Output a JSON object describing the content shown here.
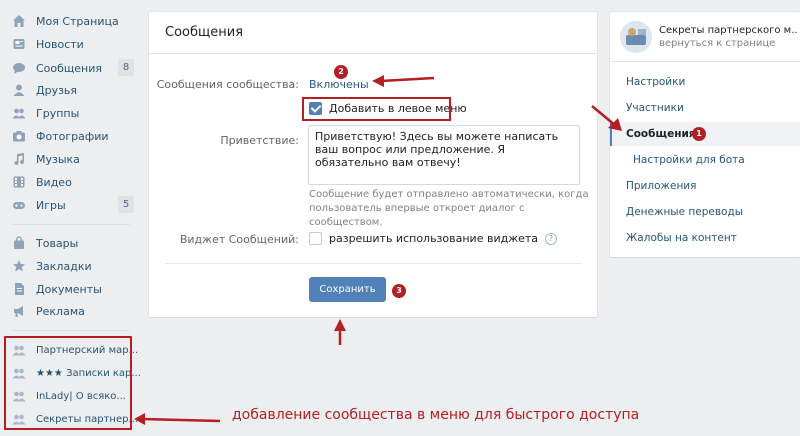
{
  "sidebar": {
    "items": [
      {
        "label": "Моя Страница",
        "icon": "home-icon"
      },
      {
        "label": "Новости",
        "icon": "news-icon"
      },
      {
        "label": "Сообщения",
        "icon": "messages-icon",
        "count": "8"
      },
      {
        "label": "Друзья",
        "icon": "friends-icon"
      },
      {
        "label": "Группы",
        "icon": "groups-icon"
      },
      {
        "label": "Фотографии",
        "icon": "camera-icon"
      },
      {
        "label": "Музыка",
        "icon": "music-icon"
      },
      {
        "label": "Видео",
        "icon": "video-icon"
      },
      {
        "label": "Игры",
        "icon": "games-icon",
        "count": "5"
      }
    ],
    "items2": [
      {
        "label": "Товары",
        "icon": "bag-icon"
      },
      {
        "label": "Закладки",
        "icon": "star-icon"
      },
      {
        "label": "Документы",
        "icon": "document-icon"
      },
      {
        "label": "Реклама",
        "icon": "ads-icon"
      }
    ],
    "groups": [
      {
        "label": "Партнерский мар..."
      },
      {
        "label": "★★★ Записки кар..."
      },
      {
        "label": "InLady| О всяко..."
      },
      {
        "label": "Секреты партнер..."
      }
    ]
  },
  "main": {
    "title": "Сообщения",
    "community_messages_label": "Сообщения сообщества:",
    "community_messages_value": "Включены",
    "add_to_menu_label": "Добавить в левое меню",
    "add_to_menu_checked": true,
    "greeting_label": "Приветствие:",
    "greeting_text": "Приветствую! Здесь вы можете написать ваш вопрос или предложение. Я обязательно вам отвечу!",
    "greeting_hint": "Сообщение будет отправлено автоматически, когда пользователь впервые откроет диалог с сообществом.",
    "widget_label": "Виджет Сообщений:",
    "widget_checkbox_label": "разрешить использование виджета",
    "widget_checked": false,
    "help": "?",
    "save_label": "Сохранить"
  },
  "right_panel": {
    "title": "Секреты партнерского м...",
    "subtitle": "вернуться к странице",
    "items": [
      {
        "label": "Настройки"
      },
      {
        "label": "Участники"
      },
      {
        "label": "Сообщения",
        "active": true
      },
      {
        "label": "Настройки для бота",
        "sub": true
      },
      {
        "label": "Приложения"
      },
      {
        "label": "Денежные переводы"
      },
      {
        "label": "Жалобы на контент"
      }
    ]
  },
  "annotations": {
    "badge1": "1",
    "badge2": "2",
    "badge3": "3",
    "caption": "добавление сообщества в меню для быстрого доступа",
    "color": "#b21f24"
  },
  "colors": {
    "accent": "#5181b8",
    "link": "#285473",
    "background": "#edeef0"
  }
}
